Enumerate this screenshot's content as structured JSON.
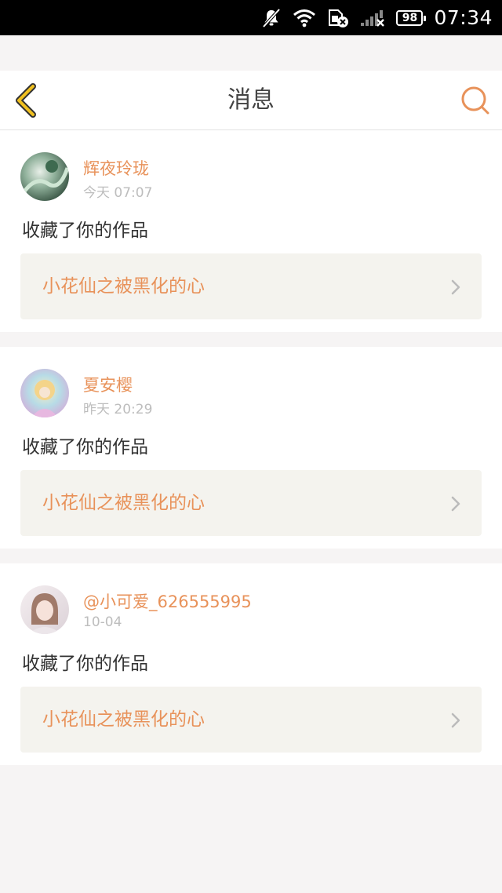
{
  "status_bar": {
    "time": "07:34",
    "battery": "98",
    "icons": [
      "notifications-muted-icon",
      "wifi-icon",
      "sim-card-icon",
      "signal-icon"
    ]
  },
  "header": {
    "title": "消息",
    "back_icon": "chevron-left-icon",
    "search_icon": "search-icon"
  },
  "messages": [
    {
      "username": "辉夜玲珑",
      "timestamp": "今天 07:07",
      "action": "收藏了你的作品",
      "work_title": "小花仙之被黑化的心"
    },
    {
      "username": "夏安樱",
      "timestamp": "昨天 20:29",
      "action": "收藏了你的作品",
      "work_title": "小花仙之被黑化的心"
    },
    {
      "username": "@小可爱_626555995",
      "timestamp": "10-04",
      "action": "收藏了你的作品",
      "work_title": "小花仙之被黑化的心"
    }
  ],
  "colors": {
    "accent": "#e8925a",
    "back_arrow": "#f0c020",
    "card_link_bg": "#f4f3ee",
    "page_bg": "#f6f4f4"
  }
}
